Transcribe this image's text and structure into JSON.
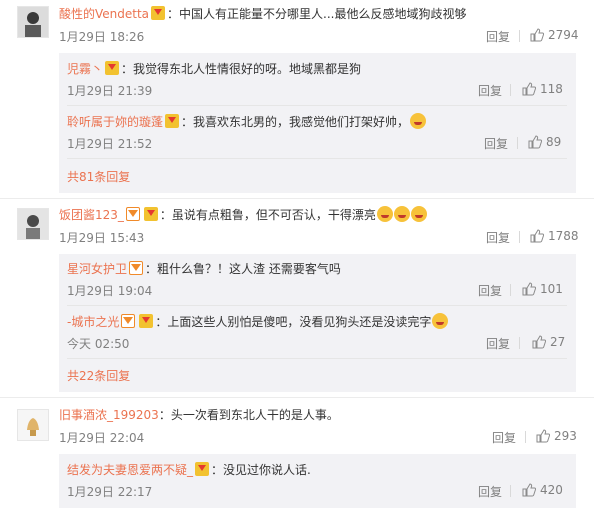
{
  "actions": {
    "reply": "回复"
  },
  "threads": [
    {
      "user": "酸性的Vendetta",
      "text": "：中国人有正能量不分哪里人...最他么反感地域狗歧视够",
      "time": "1月29日 18:26",
      "likes": "2794",
      "replies": [
        {
          "user": "児霧丶",
          "text": "：我觉得东北人性情很好的呀。地域黑都是狗",
          "time": "1月29日 21:39",
          "likes": "118"
        },
        {
          "user": "聆听属于妳的璇蓬",
          "text": "：我喜欢东北男的，我感觉他们打架好帅，",
          "time": "1月29日 21:52",
          "likes": "89"
        }
      ],
      "more": "共81条回复"
    },
    {
      "user": "饭团酱123_",
      "text": "：虽说有点粗鲁，但不可否认，干得漂亮",
      "time": "1月29日 15:43",
      "likes": "1788",
      "replies": [
        {
          "user": "星河女护卫",
          "text": "：粗什么鲁？！这人渣 还需要客气吗",
          "time": "1月29日 19:04",
          "likes": "101"
        },
        {
          "user": "-城市之光",
          "text": "：上面这些人别怕是傻吧，没看见狗头还是没读完字",
          "time": "今天 02:50",
          "likes": "27"
        }
      ],
      "more": "共22条回复"
    },
    {
      "user": "旧事酒浓_199203",
      "text": "：头一次看到东北人干的是人事。",
      "time": "1月29日 22:04",
      "likes": "293",
      "replies": [
        {
          "user": "结发为夫妻恩爱两不疑_",
          "text": "：没见过你说人话.",
          "time": "1月29日 22:17",
          "likes": "420"
        }
      ]
    }
  ]
}
